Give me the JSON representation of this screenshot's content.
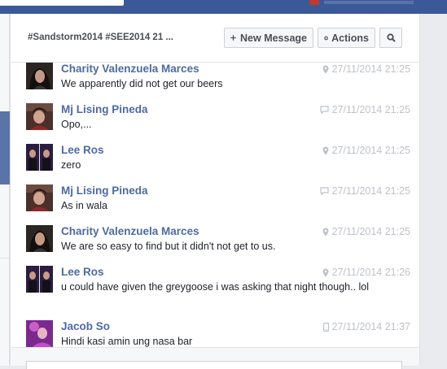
{
  "conversation": {
    "title": "#Sandstorm2014 #SEE2014  21 ..."
  },
  "toolbar": {
    "new_message_label": "New Message",
    "actions_label": "Actions"
  },
  "colors": {
    "topbar": "#3b5998",
    "name_link": "#4e6aa1",
    "timestamp": "#bec3c9"
  },
  "messages": [
    {
      "name": "Charity Valenzuela Marces",
      "text": "We apparently did not get our beers",
      "time": "27/11/2014 21:25",
      "source_icon": "location-pin-icon",
      "avatar": "avatar-charity"
    },
    {
      "name": "Mj Lising Pineda",
      "text": "Opo,...",
      "time": "27/11/2014 21:25",
      "source_icon": "chat-bubble-icon",
      "avatar": "avatar-mj"
    },
    {
      "name": "Lee Ros",
      "text": "zero",
      "time": "27/11/2014 21:25",
      "source_icon": "location-pin-icon",
      "avatar": "avatar-lee"
    },
    {
      "name": "Mj Lising Pineda",
      "text": "As in wala",
      "time": "27/11/2014 21:25",
      "source_icon": "chat-bubble-icon",
      "avatar": "avatar-mj"
    },
    {
      "name": "Charity Valenzuela Marces",
      "text": "We are so easy to find but it didn't not get to us.",
      "time": "27/11/2014 21:25",
      "source_icon": "location-pin-icon",
      "avatar": "avatar-charity"
    },
    {
      "name": "Lee Ros",
      "text": "u could have given the greygoose i was asking that night though.. lol",
      "time": "27/11/2014 21:26",
      "source_icon": "location-pin-icon",
      "avatar": "avatar-lee"
    },
    {
      "name": "Jacob So",
      "text": "Hindi kasi amin ung nasa bar",
      "time": "27/11/2014 21:37",
      "source_icon": "mobile-phone-icon",
      "avatar": "avatar-jacob"
    }
  ]
}
